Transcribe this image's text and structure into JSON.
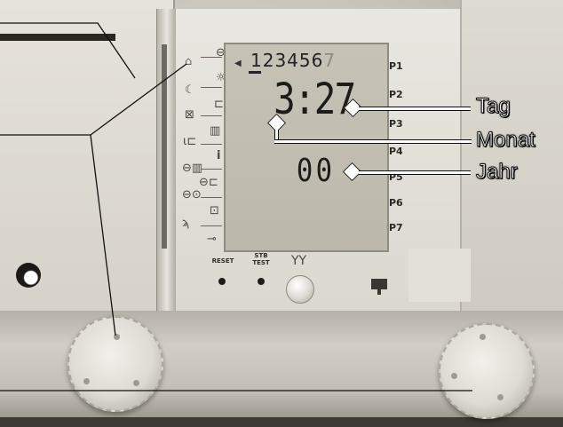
{
  "display": {
    "days_active": "123456",
    "days_inactive": "7",
    "time_value": "3:27",
    "year_value": "00"
  },
  "program_labels": [
    "P1",
    "P2",
    "P3",
    "P4",
    "P5",
    "P6",
    "P7"
  ],
  "buttons": {
    "reset_label": "RESET",
    "stb_label_line1": "STB",
    "stb_label_line2": "TEST"
  },
  "callouts": {
    "tag": "Tag",
    "monat": "Monat",
    "jahr": "Jahr"
  },
  "icons": [
    "clock-icon",
    "house-icon",
    "sun-icon",
    "moon-icon",
    "tap-icon",
    "frost-icon",
    "radiator-icon",
    "thermometer-icon",
    "info-icon",
    "clock-radiator-icon",
    "clock-tap-icon",
    "clock-program-icon",
    "briefcase-icon",
    "wrench-icon",
    "key-icon",
    "glasses-icon",
    "chip-icon"
  ],
  "colors": {
    "lcd": "#c2bdb1",
    "housing": "#dcd9d1",
    "callout_text": "#ffffff"
  }
}
